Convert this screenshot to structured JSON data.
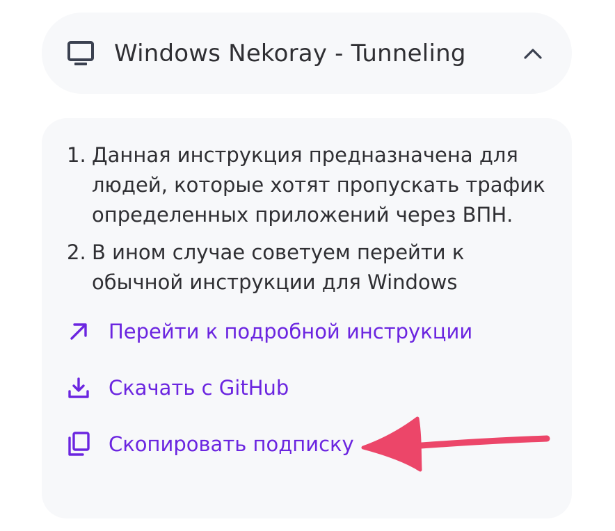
{
  "accordion": {
    "title": "Windows Nekoray - Tunneling",
    "icon": "monitor-icon",
    "toggle_icon": "chevron-up-icon",
    "expanded": true
  },
  "instructions": {
    "steps": [
      {
        "number": "1.",
        "text": "Данная инструкция предназначена для людей, которые хотят пропускать трафик определенных приложений через ВПН."
      },
      {
        "number": "2.",
        "text": "В ином случае советуем перейти к обычной инструкции для Windows"
      }
    ]
  },
  "actions": {
    "open_guide": {
      "label": "Перейти к подробной инструкции",
      "icon": "arrow-up-right-icon"
    },
    "download": {
      "label": "Скачать с GitHub",
      "icon": "download-icon"
    },
    "copy_subscription": {
      "label": "Скопировать подписку",
      "icon": "copy-icon"
    }
  },
  "annotation": {
    "icon": "pointer-arrow-icon"
  },
  "colors": {
    "accent": "#6b25e0",
    "text": "#2f2f33",
    "card_bg": "#f7f8fa",
    "annotation_arrow": "#ec4669"
  }
}
